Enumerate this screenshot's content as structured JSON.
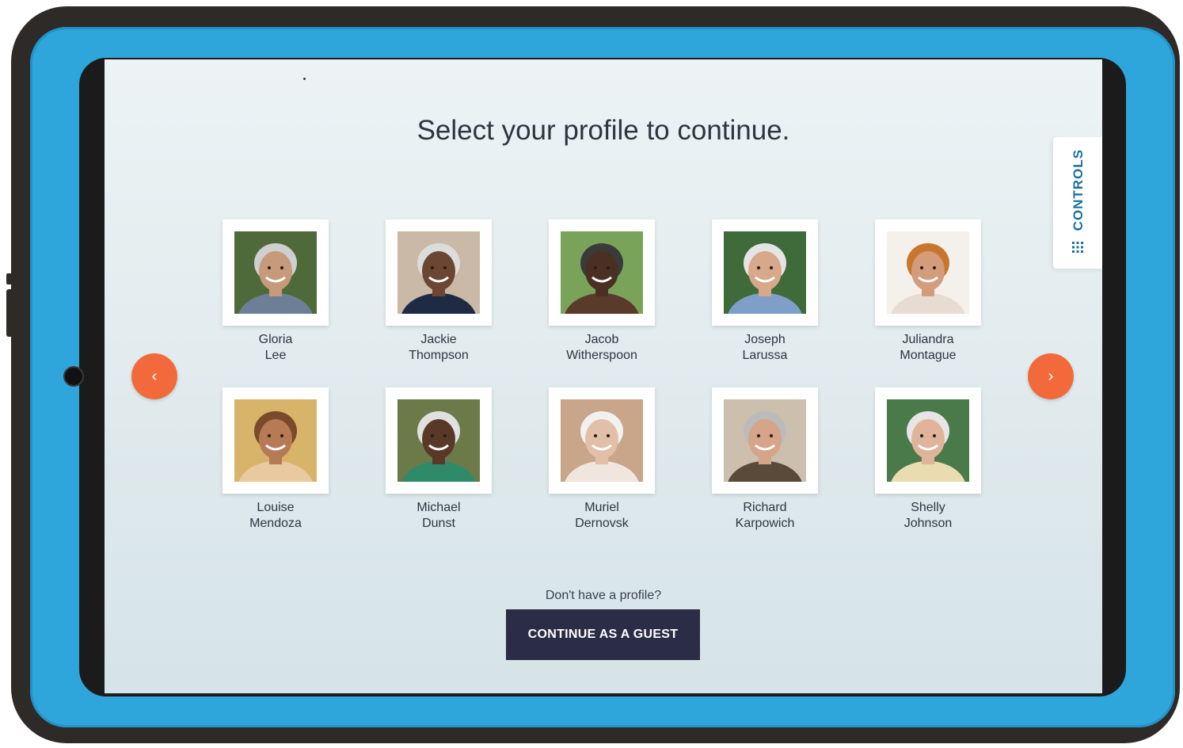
{
  "screen": {
    "title": "Select your profile to continue.",
    "controls_label": "CONTROLS",
    "controls_icon": "grid-icon",
    "prev_icon": "chevron-left-icon",
    "next_icon": "chevron-right-icon",
    "prev_glyph": "‹",
    "next_glyph": "›",
    "accent_color": "#f26a3c",
    "button_color": "#2b2c45",
    "case_color": "#2ea6db"
  },
  "profiles": [
    {
      "first": "Gloria",
      "last": "Lee",
      "photo": "photo-gloria",
      "bg": "#4f6a3a",
      "skin": "#c69a7a",
      "hair": "#cfcfcf",
      "shirt": "#6d7f96"
    },
    {
      "first": "Jackie",
      "last": "Thompson",
      "photo": "photo-jackie",
      "bg": "#c9b9a6",
      "skin": "#6b4632",
      "hair": "#dcdcdc",
      "shirt": "#1f2a44"
    },
    {
      "first": "Jacob",
      "last": "Witherspoon",
      "photo": "photo-jacob",
      "bg": "#7aa35a",
      "skin": "#4a3022",
      "hair": "#3a3a3a",
      "shirt": "#5a3a2a"
    },
    {
      "first": "Joseph",
      "last": "Larussa",
      "photo": "photo-joseph",
      "bg": "#3f6a3a",
      "skin": "#d8a88a",
      "hair": "#e4e4e4",
      "shirt": "#7f9fc8"
    },
    {
      "first": "Juliandra",
      "last": "Montague",
      "photo": "photo-juliandra",
      "bg": "#f4f1ec",
      "skin": "#d39c7a",
      "hair": "#c8762e",
      "shirt": "#e6dcd2"
    },
    {
      "first": "Louise",
      "last": "Mendoza",
      "photo": "photo-louise",
      "bg": "#d8b46a",
      "skin": "#b57a56",
      "hair": "#7a4a2a",
      "shirt": "#e8c9a0"
    },
    {
      "first": "Michael",
      "last": "Dunst",
      "photo": "photo-michael",
      "bg": "#6c7a4a",
      "skin": "#5a3826",
      "hair": "#e0e0e0",
      "shirt": "#2f8a6a"
    },
    {
      "first": "Muriel",
      "last": "Dernovsk",
      "photo": "photo-muriel",
      "bg": "#c9a58a",
      "skin": "#e2bfa8",
      "hair": "#f1f1f1",
      "shirt": "#efe7de"
    },
    {
      "first": "Richard",
      "last": "Karpowich",
      "photo": "photo-richard",
      "bg": "#cdbfae",
      "skin": "#d6a488",
      "hair": "#bbbbbb",
      "shirt": "#5a4a3a"
    },
    {
      "first": "Shelly",
      "last": "Johnson",
      "photo": "photo-shelly",
      "bg": "#4a7a4a",
      "skin": "#e0b49a",
      "hair": "#e6e6e6",
      "shirt": "#e8dcb0"
    }
  ],
  "footer": {
    "prompt": "Don't have a profile?",
    "guest_button": "CONTINUE AS A GUEST"
  }
}
